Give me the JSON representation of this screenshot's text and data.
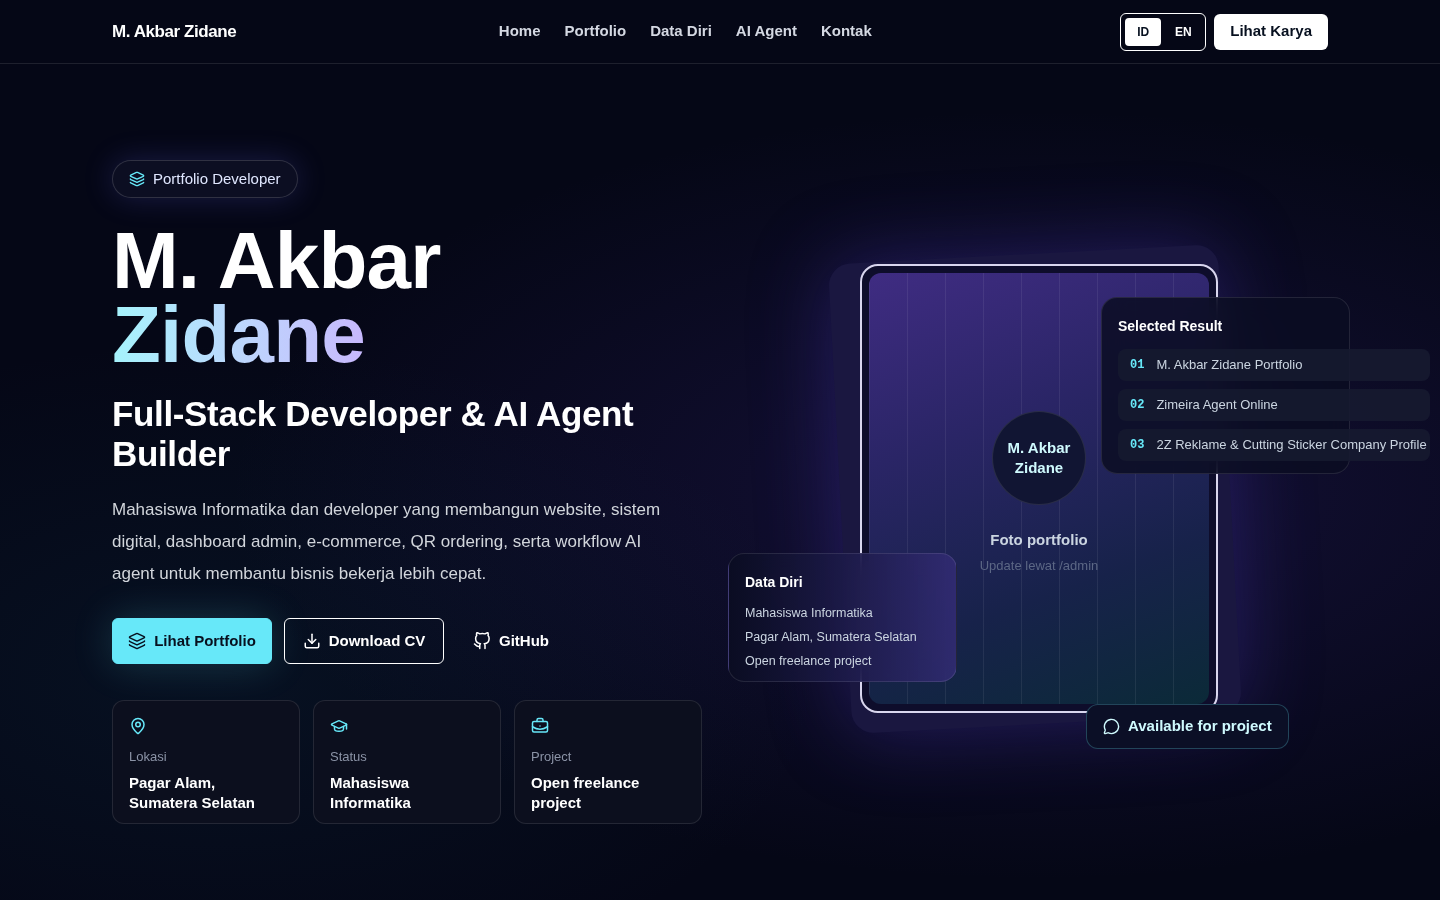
{
  "navbar": {
    "brand": "M. Akbar Zidane",
    "links": [
      "Home",
      "Portfolio",
      "Data Diri",
      "AI Agent",
      "Kontak"
    ],
    "languages": [
      {
        "label": "ID",
        "selected": true
      },
      {
        "label": "EN",
        "selected": false
      }
    ],
    "cta": "Lihat Karya"
  },
  "hero": {
    "badge": "Portfolio Developer",
    "name_first": "M. Akbar",
    "name_last": "Zidane",
    "headline": "Full-Stack Developer & AI Agent Builder",
    "description": "Mahasiswa Informatika dan developer yang membangun website, sistem digital, dashboard admin, e-commerce, QR ordering, serta workflow AI agent untuk membantu bisnis bekerja lebih cepat.",
    "buttons": [
      {
        "kind": "primary",
        "label": "Lihat Portfolio"
      },
      {
        "kind": "outline",
        "label": "Download CV"
      },
      {
        "kind": "ghost",
        "label": "GitHub"
      }
    ],
    "info_cards": [
      {
        "kind": "location",
        "label": "Lokasi",
        "value": "Pagar Alam, Sumatera Selatan"
      },
      {
        "kind": "status",
        "label": "Status",
        "value": "Mahasiswa Informatika"
      },
      {
        "kind": "project",
        "label": "Project",
        "value": "Open freelance project"
      }
    ]
  },
  "visual": {
    "avatar": "M. Akbar Zidane",
    "photo_title": "Foto portfolio",
    "photo_hint": "Update lewat /admin",
    "selected_result": {
      "title": "Selected Result",
      "items": [
        {
          "number": "01",
          "title": "M. Akbar Zidane Portfolio"
        },
        {
          "number": "02",
          "title": "Zimeira Agent Online"
        },
        {
          "number": "03",
          "title": "2Z Reklame & Cutting Sticker Company Profile"
        }
      ]
    },
    "data_diri": {
      "title": "Data Diri",
      "lines": [
        "Mahasiswa Informatika",
        "Pagar Alam, Sumatera Selatan",
        "Open freelance project"
      ]
    },
    "availability": "Available for project"
  }
}
